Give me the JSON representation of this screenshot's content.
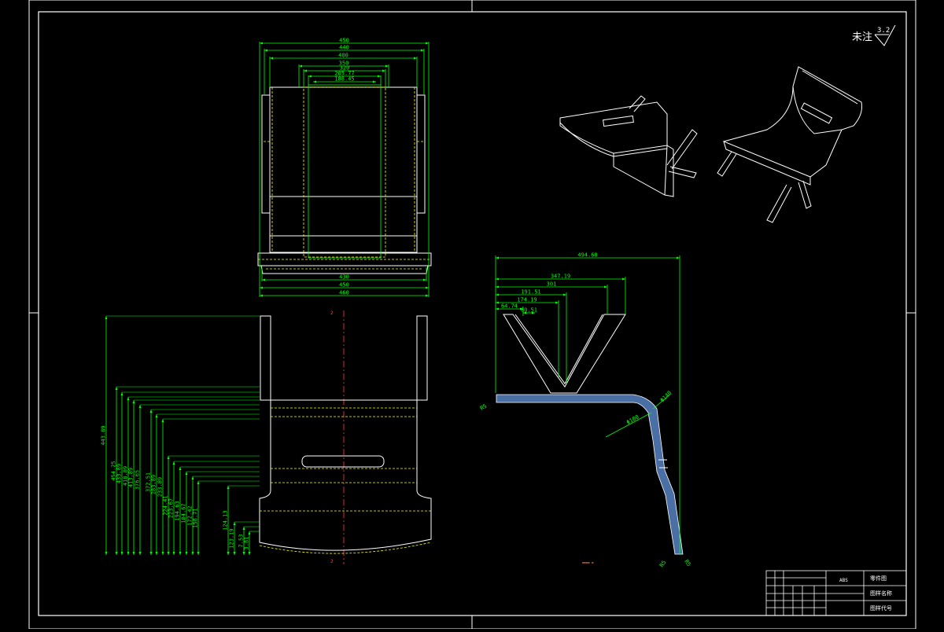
{
  "colors": {
    "background": "#000000",
    "outline": "#ffffff",
    "dimension": "#00ff00",
    "hidden_yellow": "#ffff00",
    "centerline": "#ff4040",
    "section_fill": "#4a6fa5"
  },
  "note": {
    "label": "未注",
    "roughness": "3.2"
  },
  "top_view": {
    "width_dims": [
      "450",
      "440",
      "400",
      "350",
      "320",
      "205.77",
      "188.45"
    ],
    "bottom_dims": [
      "430",
      "450",
      "460"
    ]
  },
  "front_view": {
    "height_dims": [
      "443.89",
      "454.25",
      "433.89",
      "418.89",
      "413.89",
      "376.65",
      "372.51",
      "283.89",
      "233.89",
      "224.41",
      "223.67",
      "194.63",
      "184.67",
      "172.42",
      "158.71",
      "124.13",
      "123.19",
      "7.53",
      "3.81"
    ],
    "center_mark": "2"
  },
  "section_view": {
    "horizontal_dims": [
      "494.68",
      "347.19",
      "301",
      "191.51",
      "174.19",
      "64.74",
      "80.51"
    ],
    "radius_labels": [
      "R5",
      "Φ140",
      "Φ100",
      "R5",
      "R5"
    ],
    "tiny_label": "▬▬▬▬ ▬"
  },
  "title_block": {
    "material": "ABS",
    "fields": [
      "零件图",
      "图样名称",
      "图样代号"
    ]
  }
}
